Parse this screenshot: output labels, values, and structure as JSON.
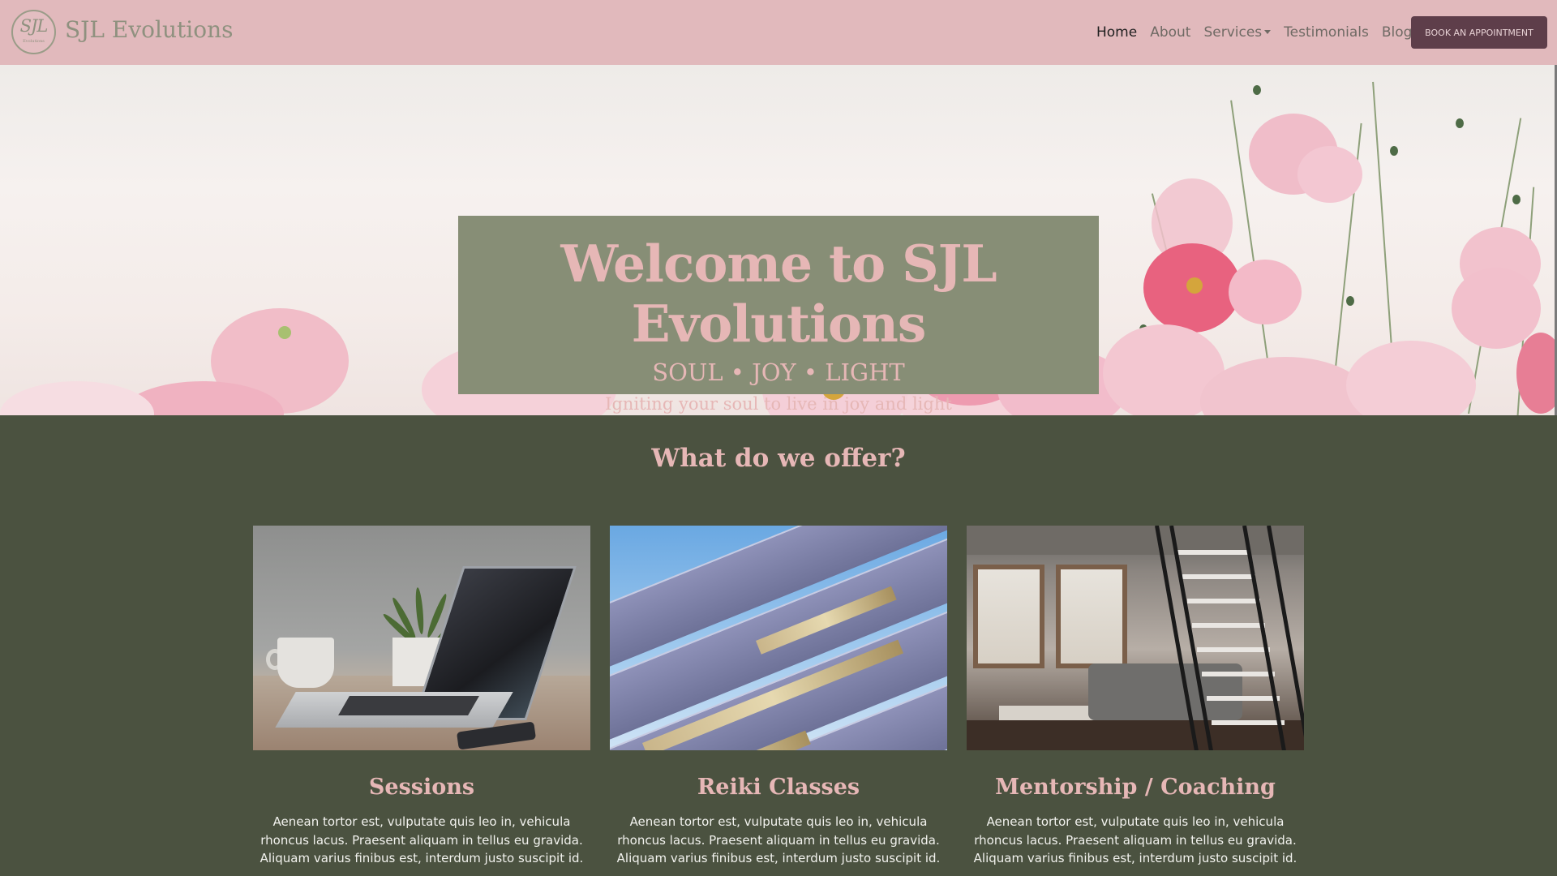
{
  "brand": {
    "name": "SJL Evolutions",
    "logo_mark": "SJL",
    "logo_sub": "Evolutions"
  },
  "nav": {
    "items": [
      {
        "label": "Home",
        "active": true
      },
      {
        "label": "About",
        "active": false
      },
      {
        "label": "Services",
        "active": false,
        "dropdown": true
      },
      {
        "label": "Testimonials",
        "active": false
      },
      {
        "label": "Blog",
        "active": false
      }
    ],
    "cta_label": "BOOK AN APPOINTMENT"
  },
  "hero": {
    "title": "Welcome to SJL Evolutions",
    "subtitle": "SOUL • JOY • LIGHT",
    "tagline": "Igniting your soul to live in joy and light"
  },
  "offer": {
    "heading": "What do we offer?",
    "cards": [
      {
        "title": "Sessions",
        "text": "Aenean tortor est, vulputate quis leo in, vehicula rhoncus lacus. Praesent aliquam in tellus eu gravida. Aliquam varius finibus est, interdum justo suscipit id.",
        "image": "laptop-desk-image"
      },
      {
        "title": "Reiki Classes",
        "text": "Aenean tortor est, vulputate quis leo in, vehicula rhoncus lacus. Praesent aliquam in tellus eu gravida. Aliquam varius finibus est, interdum justo suscipit id.",
        "image": "building-facade-image"
      },
      {
        "title": "Mentorship / Coaching",
        "text": "Aenean tortor est, vulputate quis leo in, vehicula rhoncus lacus. Praesent aliquam in tellus eu gravida. Aliquam varius finibus est, interdum justo suscipit id.",
        "image": "loft-interior-image"
      }
    ]
  },
  "colors": {
    "navbar_bg": "#e1b9bc",
    "cta_bg": "#5e3e4a",
    "hero_box_bg": "#878e76",
    "section_bg": "#4b5240",
    "accent_pink": "#e6b7b6"
  }
}
